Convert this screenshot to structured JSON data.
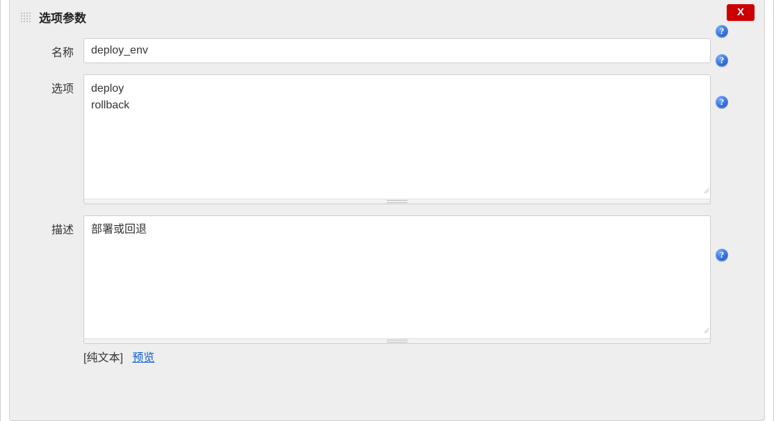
{
  "close_label": "X",
  "section": {
    "title": "选项参数"
  },
  "fields": {
    "name": {
      "label": "名称",
      "value": "deploy_env"
    },
    "options": {
      "label": "选项",
      "value": "deploy\nrollback"
    },
    "description": {
      "label": "描述",
      "value": "部署或回退",
      "mode_label": "[纯文本]",
      "preview_label": "预览"
    }
  }
}
